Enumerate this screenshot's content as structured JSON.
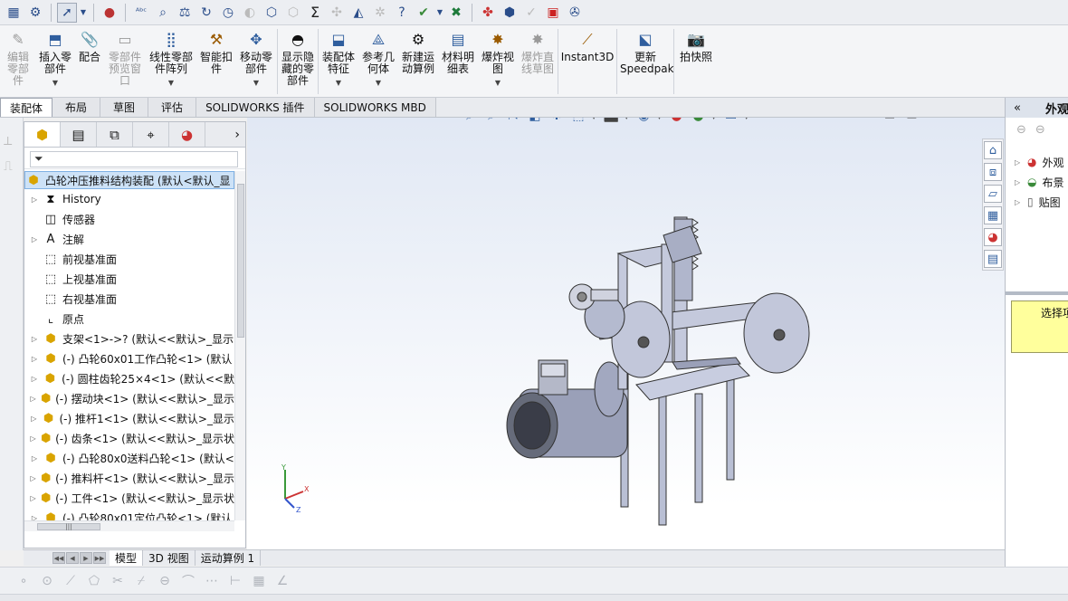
{
  "toolbar_top": {
    "icons": [
      "measure-icon",
      "settings-icon",
      "select-arrow-icon",
      "appearance-icon",
      "spell-check-icon",
      "check-icon",
      "mass-properties-icon",
      "rotate-icon",
      "clock-icon",
      "disabled-icon",
      "check-entity-icon",
      "check-entity-icon-2",
      "sum-icon",
      "dim-icon",
      "sensor-icon",
      "compare-icon",
      "help-icon",
      "more-icon",
      "excel-icon",
      "toolbox-icon",
      "design-checker-icon",
      "check-circle-icon",
      "pdm-icon",
      "forum-icon"
    ]
  },
  "ribbon": {
    "buttons": [
      {
        "label": "编辑零部件",
        "disabled": true,
        "icon": "edit-component-icon"
      },
      {
        "label": "插入零部件",
        "disabled": false,
        "icon": "insert-component-icon",
        "dropdown": true
      },
      {
        "label": "配合",
        "disabled": false,
        "icon": "mate-icon"
      },
      {
        "label": "零部件预览窗口",
        "disabled": true,
        "icon": "preview-window-icon"
      },
      {
        "label": "线性零部件阵列",
        "disabled": false,
        "icon": "linear-pattern-icon",
        "dropdown": true
      },
      {
        "label": "智能扣件",
        "disabled": false,
        "icon": "smart-fastener-icon"
      },
      {
        "label": "移动零部件",
        "disabled": false,
        "icon": "move-component-icon",
        "dropdown": true
      },
      {
        "label": "显示隐藏的零部件",
        "disabled": false,
        "icon": "show-hidden-icon"
      },
      {
        "label": "装配体特征",
        "disabled": false,
        "icon": "assembly-feature-icon",
        "dropdown": true
      },
      {
        "label": "参考几何体",
        "disabled": false,
        "icon": "reference-geometry-icon",
        "dropdown": true
      },
      {
        "label": "新建运动算例",
        "disabled": false,
        "icon": "new-motion-study-icon"
      },
      {
        "label": "材料明细表",
        "disabled": false,
        "icon": "bom-icon"
      },
      {
        "label": "爆炸视图",
        "disabled": false,
        "icon": "exploded-view-icon",
        "dropdown": true
      },
      {
        "label": "爆炸直线草图",
        "disabled": true,
        "icon": "explode-line-sketch-icon"
      },
      {
        "label": "Instant3D",
        "disabled": false,
        "icon": "instant3d-icon"
      },
      {
        "label": "更新Speedpak",
        "disabled": false,
        "icon": "speedpak-icon"
      },
      {
        "label": "拍快照",
        "disabled": false,
        "icon": "snapshot-icon"
      }
    ]
  },
  "tabs": [
    "装配体",
    "布局",
    "草图",
    "评估",
    "SOLIDWORKS 插件",
    "SOLIDWORKS MBD"
  ],
  "active_tab": "装配体",
  "feature_manager": {
    "root": "凸轮冲压推料结构装配  (默认<默认_显",
    "items": [
      {
        "label": "History",
        "icon": "history-icon",
        "expandable": true
      },
      {
        "label": "传感器",
        "icon": "sensor-icon",
        "expandable": false
      },
      {
        "label": "注解",
        "icon": "annotation-icon",
        "expandable": true
      },
      {
        "label": "前视基准面",
        "icon": "plane-icon",
        "expandable": false
      },
      {
        "label": "上视基准面",
        "icon": "plane-icon",
        "expandable": false
      },
      {
        "label": "右视基准面",
        "icon": "plane-icon",
        "expandable": false
      },
      {
        "label": "原点",
        "icon": "origin-icon",
        "expandable": false
      },
      {
        "label": "支架<1>->? (默认<<默认>_显示",
        "icon": "part-icon",
        "expandable": true
      },
      {
        "label": "(-) 凸轮60x01工作凸轮<1> (默认",
        "icon": "part-icon",
        "expandable": true
      },
      {
        "label": "(-) 圆柱齿轮25×4<1> (默认<<默",
        "icon": "part-icon",
        "expandable": true
      },
      {
        "label": "(-) 摆动块<1> (默认<<默认>_显示",
        "icon": "part-icon",
        "expandable": true
      },
      {
        "label": "(-) 推杆1<1> (默认<<默认>_显示",
        "icon": "part-icon",
        "expandable": true
      },
      {
        "label": "(-) 齿条<1> (默认<<默认>_显示状",
        "icon": "part-icon",
        "expandable": true
      },
      {
        "label": "(-) 凸轮80x0送料凸轮<1> (默认<",
        "icon": "part-icon",
        "expandable": true
      },
      {
        "label": "(-) 推料杆<1> (默认<<默认>_显示",
        "icon": "part-icon",
        "expandable": true
      },
      {
        "label": "(-) 工件<1> (默认<<默认>_显示状",
        "icon": "part-icon",
        "expandable": true
      },
      {
        "label": "(-) 凸轮80x01定位凸轮<1> (默认",
        "icon": "part-icon",
        "expandable": true
      }
    ]
  },
  "bottom_tabs": [
    "模型",
    "3D 视图",
    "运动算例 1"
  ],
  "active_bottom_tab": "模型",
  "task_pane": {
    "title": "外观",
    "items": [
      {
        "label": "外观",
        "icon": "appearance-sphere-icon"
      },
      {
        "label": "布景",
        "icon": "scene-icon"
      },
      {
        "label": "贴图",
        "icon": "decal-icon"
      }
    ],
    "note": "选择项"
  },
  "colors": {
    "accent": "#2f5e9e",
    "selection": "#cde2f7",
    "part_yellow": "#d9a400",
    "note_yellow": "#ffff9c"
  }
}
